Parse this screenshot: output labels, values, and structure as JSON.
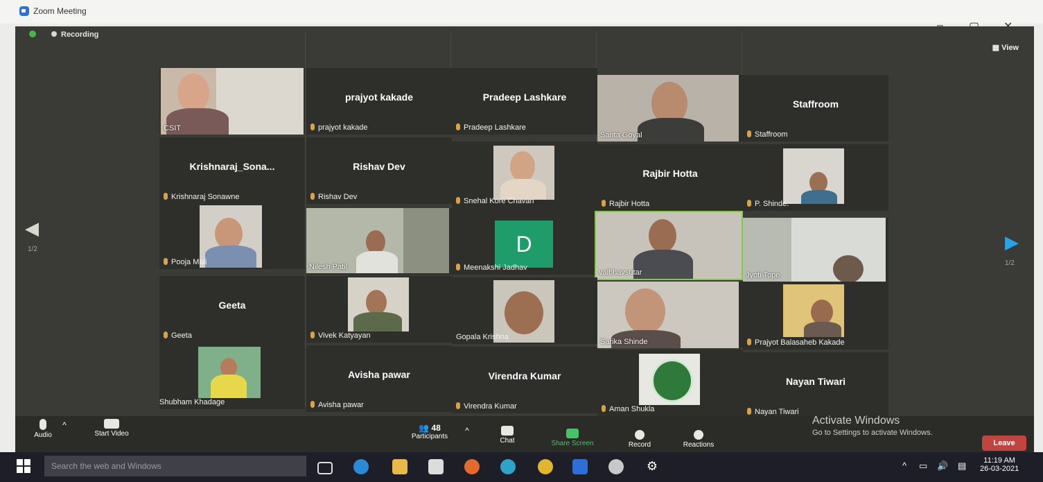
{
  "window": {
    "title": "Zoom Meeting",
    "minimize": "–",
    "restore": "▢",
    "close": "✕"
  },
  "meeting": {
    "recording_label": "Recording",
    "view_label": "View",
    "page_left": "1/2",
    "page_right": "1/2"
  },
  "tiles": [
    {
      "id": "t1",
      "kind": "video",
      "tag": "CSIT"
    },
    {
      "id": "t2",
      "kind": "name",
      "center": "prajyot kakade",
      "label": "prajyot kakade"
    },
    {
      "id": "t3",
      "kind": "name",
      "center": "Pradeep Lashkare",
      "label": "Pradeep Lashkare"
    },
    {
      "id": "t4",
      "kind": "video",
      "tag": "Sarita Goyal"
    },
    {
      "id": "t5",
      "kind": "name",
      "center": "Staffroom",
      "label": "Staffroom"
    },
    {
      "id": "t6",
      "kind": "name",
      "center": "Krishnaraj_Sona...",
      "label": "Krishnaraj Sonawne"
    },
    {
      "id": "t7",
      "kind": "name",
      "center": "Rishav Dev",
      "label": "Rishav Dev"
    },
    {
      "id": "t8",
      "kind": "video",
      "tag": "Snehal Kore Chavan"
    },
    {
      "id": "t9",
      "kind": "name",
      "center": "Rajbir Hotta",
      "label": "Rajbir Hotta"
    },
    {
      "id": "t10",
      "kind": "video",
      "tag": "P. Shinde."
    },
    {
      "id": "t11",
      "kind": "video",
      "tag": "Pooja Mali"
    },
    {
      "id": "t12",
      "kind": "video",
      "tag": "Nilesh Patil"
    },
    {
      "id": "t13",
      "kind": "avatar",
      "letter": "D",
      "tag": "Meenakshi Jadhav"
    },
    {
      "id": "t14",
      "kind": "video",
      "tag": "vaibhavsutar"
    },
    {
      "id": "t15",
      "kind": "video",
      "tag": "Jyoti Tope"
    },
    {
      "id": "t16",
      "kind": "name",
      "center": "Geeta",
      "label": "Geeta"
    },
    {
      "id": "t17",
      "kind": "video",
      "tag": "Vivek Katyayan"
    },
    {
      "id": "t18",
      "kind": "video",
      "tag": "Gopala Krishna"
    },
    {
      "id": "t19",
      "kind": "video",
      "tag": "Sarika Shinde"
    },
    {
      "id": "t20",
      "kind": "video",
      "tag": "Prajyot Balasaheb Kakade"
    },
    {
      "id": "t21",
      "kind": "video",
      "tag": "Shubham Khadage"
    },
    {
      "id": "t22",
      "kind": "name",
      "center": "Avisha pawar",
      "label": "Avisha pawar"
    },
    {
      "id": "t23",
      "kind": "name",
      "center": "Virendra Kumar",
      "label": "Virendra Kumar"
    },
    {
      "id": "t24",
      "kind": "video",
      "tag": "Aman Shukla"
    },
    {
      "id": "t25",
      "kind": "name",
      "center": "Nayan Tiwari",
      "label": "Nayan Tiwari"
    }
  ],
  "toolbar": {
    "audio": "Audio",
    "start_video": "Start Video",
    "participants": "Participants",
    "participants_count": "48",
    "chat": "Chat",
    "share_screen": "Share Screen",
    "record": "Record",
    "reactions": "Reactions",
    "leave": "Leave"
  },
  "activate": {
    "line1": "Activate Windows",
    "line2": "Go to Settings to activate Windows."
  },
  "taskbar": {
    "search_placeholder": "Search the web and Windows",
    "time": "11:19 AM",
    "date": "26-03-2021"
  },
  "colors": {
    "meeting_bg": "#3a3a36",
    "leave_red": "#c0443f",
    "arrow_blue": "#2aa3e6",
    "avatar_green": "#1f9c6a"
  }
}
